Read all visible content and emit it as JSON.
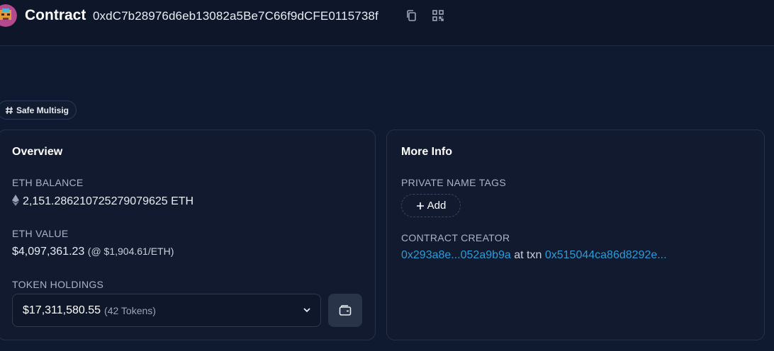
{
  "header": {
    "title": "Contract",
    "address": "0xdC7b28976d6eb13082a5Be7C66f9dCFE0115738f",
    "icons": [
      "copy-icon",
      "qr-code-icon"
    ]
  },
  "tag": {
    "label": "Safe Multisig",
    "icon": "hash-icon"
  },
  "overview": {
    "title": "Overview",
    "eth_balance_label": "ETH BALANCE",
    "eth_balance_value": "2,151.286210725279079625 ETH",
    "eth_value_label": "ETH VALUE",
    "eth_value_usd": "$4,097,361.23",
    "eth_price": "(@ $1,904.61/ETH)",
    "token_holdings_label": "TOKEN HOLDINGS",
    "token_holdings_value": "$17,311,580.55",
    "token_holdings_count": "(42 Tokens)"
  },
  "more_info": {
    "title": "More Info",
    "private_tags_label": "PRIVATE NAME TAGS",
    "add_label": "Add",
    "creator_label": "CONTRACT CREATOR",
    "creator_address": "0x293a8e...052a9b9a",
    "at_txn_text": "at txn",
    "creator_txn": "0x515044ca86d8292e..."
  },
  "colors": {
    "background": "#0f1a30",
    "card": "#111a2e",
    "link": "#2e9bd8",
    "label": "#aab4c6"
  }
}
